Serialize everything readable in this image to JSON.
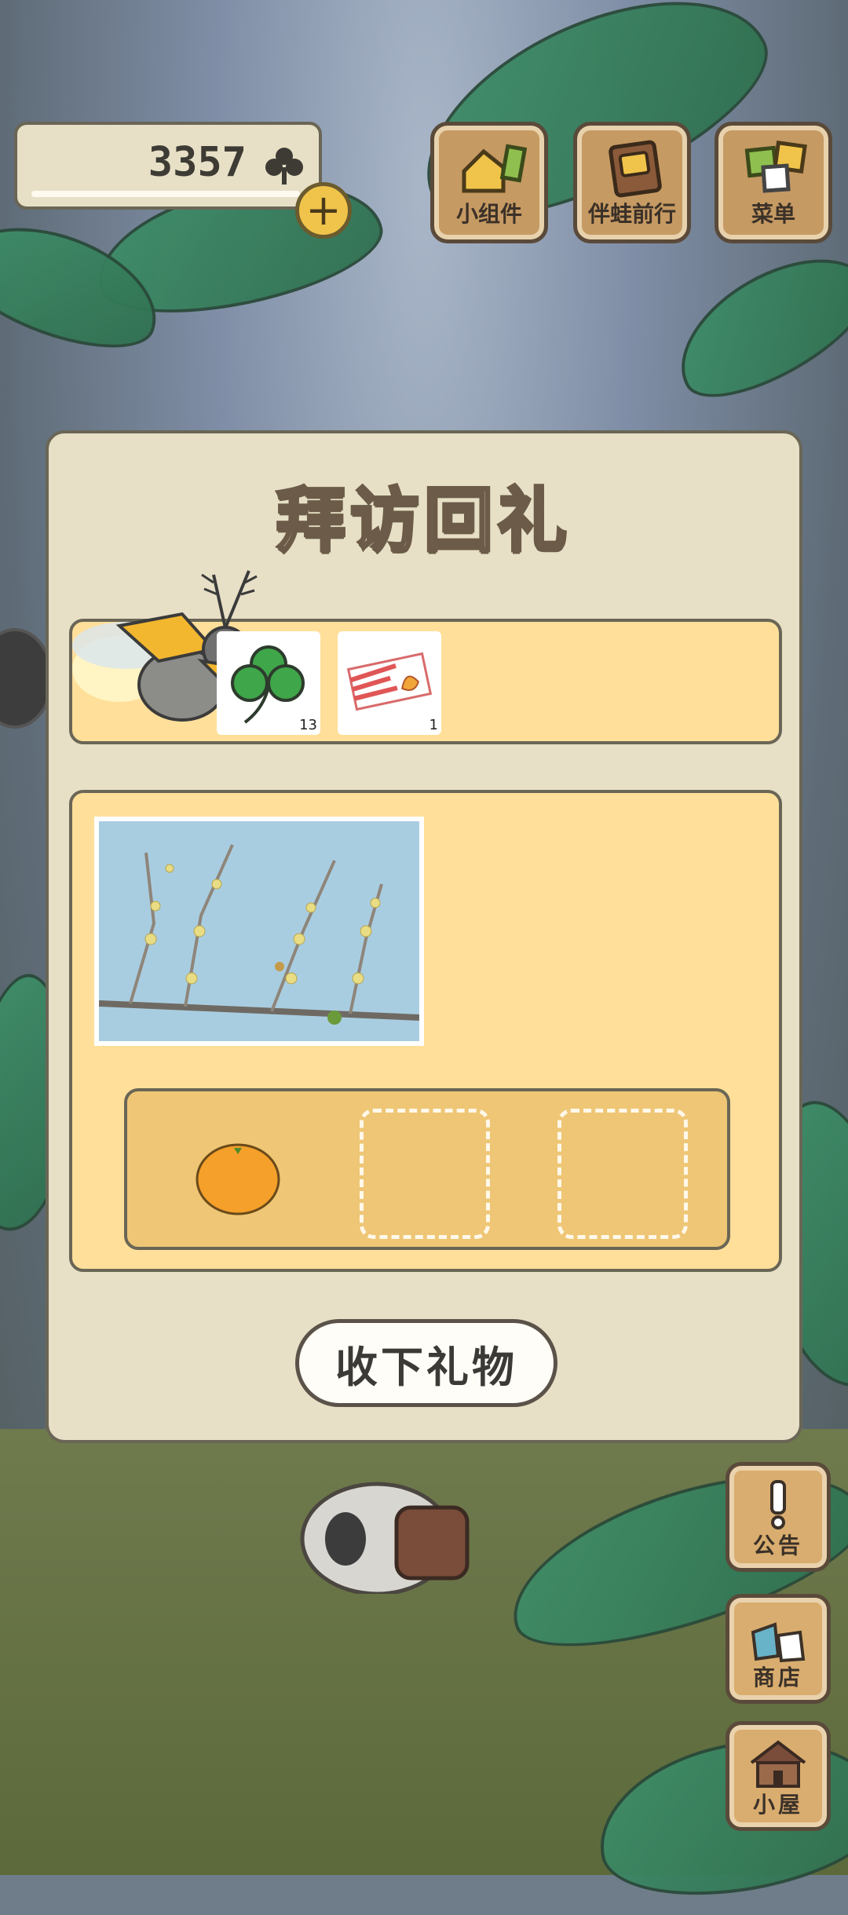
{
  "currency": {
    "amount": "3357",
    "icon": "clover-icon",
    "add_icon": "+"
  },
  "top_buttons": [
    {
      "label": "小组件",
      "icon": "widget-icon"
    },
    {
      "label": "伴蛙前行",
      "icon": "journey-book-icon"
    },
    {
      "label": "菜单",
      "icon": "menu-icon"
    }
  ],
  "dialog": {
    "title": "拜访回礼",
    "visitor": {
      "icon": "firefly-visitor-icon"
    },
    "gifts": [
      {
        "icon": "clover-icon",
        "count": "13"
      },
      {
        "icon": "ticket-icon",
        "count": "1"
      }
    ],
    "photo": {
      "icon": "plum-blossom-branch-photo"
    },
    "slots": [
      {
        "icon": "orange-icon",
        "filled": true
      },
      {
        "filled": false
      },
      {
        "filled": false
      }
    ],
    "accept_label": "收下礼物"
  },
  "side_buttons": [
    {
      "label": "公告",
      "icon": "exclamation-icon"
    },
    {
      "label": "商店",
      "icon": "shop-bags-icon"
    },
    {
      "label": "小屋",
      "icon": "house-icon"
    }
  ],
  "colors": {
    "panel": "#e7e0c6",
    "yellow_panel": "#ffdf99",
    "slot_bg": "#eec675",
    "button_wood": "#d9ad6f",
    "border": "#6a6656"
  }
}
